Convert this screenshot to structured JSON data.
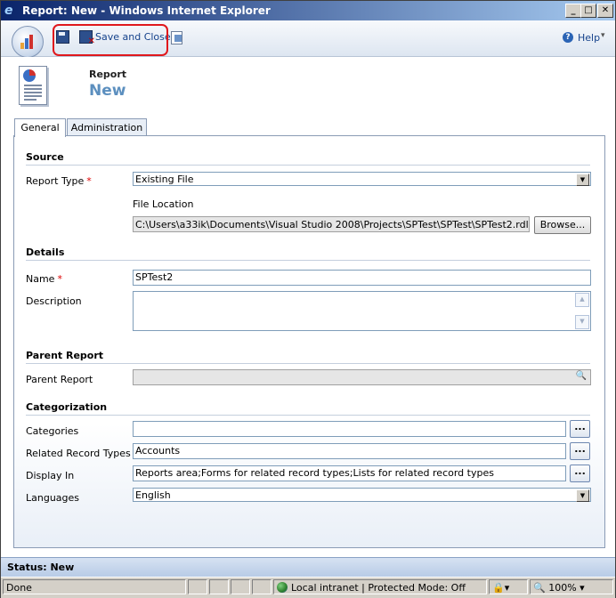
{
  "window": {
    "title": "Report: New - Windows Internet Explorer",
    "controls": [
      "_",
      "□",
      "✕"
    ]
  },
  "toolbar": {
    "save_icon": "save-icon",
    "save_close_label": "Save and Close",
    "extra_icon": "save-and-new-icon",
    "help_label": "Help",
    "help_icon": "help-icon"
  },
  "header": {
    "entity_label": "Report",
    "entity_state": "New"
  },
  "tabs": [
    {
      "label": "General",
      "active": true
    },
    {
      "label": "Administration",
      "active": false
    }
  ],
  "sections": {
    "source": {
      "title": "Source",
      "report_type_label": "Report Type",
      "report_type_value": "Existing File",
      "file_location_label": "File Location",
      "file_location_value": "C:\\Users\\a33ik\\Documents\\Visual Studio 2008\\Projects\\SPTest\\SPTest\\SPTest2.rdl",
      "browse_label": "Browse..."
    },
    "details": {
      "title": "Details",
      "name_label": "Name",
      "name_value": "SPTest2",
      "description_label": "Description",
      "description_value": ""
    },
    "parent": {
      "title": "Parent Report",
      "parent_label": "Parent Report",
      "parent_value": ""
    },
    "categorization": {
      "title": "Categorization",
      "categories_label": "Categories",
      "categories_value": "",
      "related_label": "Related Record Types",
      "related_value": "Accounts",
      "display_in_label": "Display In",
      "display_in_value": "Reports area;Forms for related record types;Lists for related record types",
      "languages_label": "Languages",
      "languages_value": "English",
      "ellipsis_label": "..."
    }
  },
  "required_marker": "*",
  "form_status": "Status: New",
  "ie_status": {
    "done": "Done",
    "zone": "Local intranet | Protected Mode: Off",
    "zoom": "100%"
  },
  "colors": {
    "highlight": "#e0181c",
    "accent": "#15428b",
    "state": "#5c8fbf"
  }
}
